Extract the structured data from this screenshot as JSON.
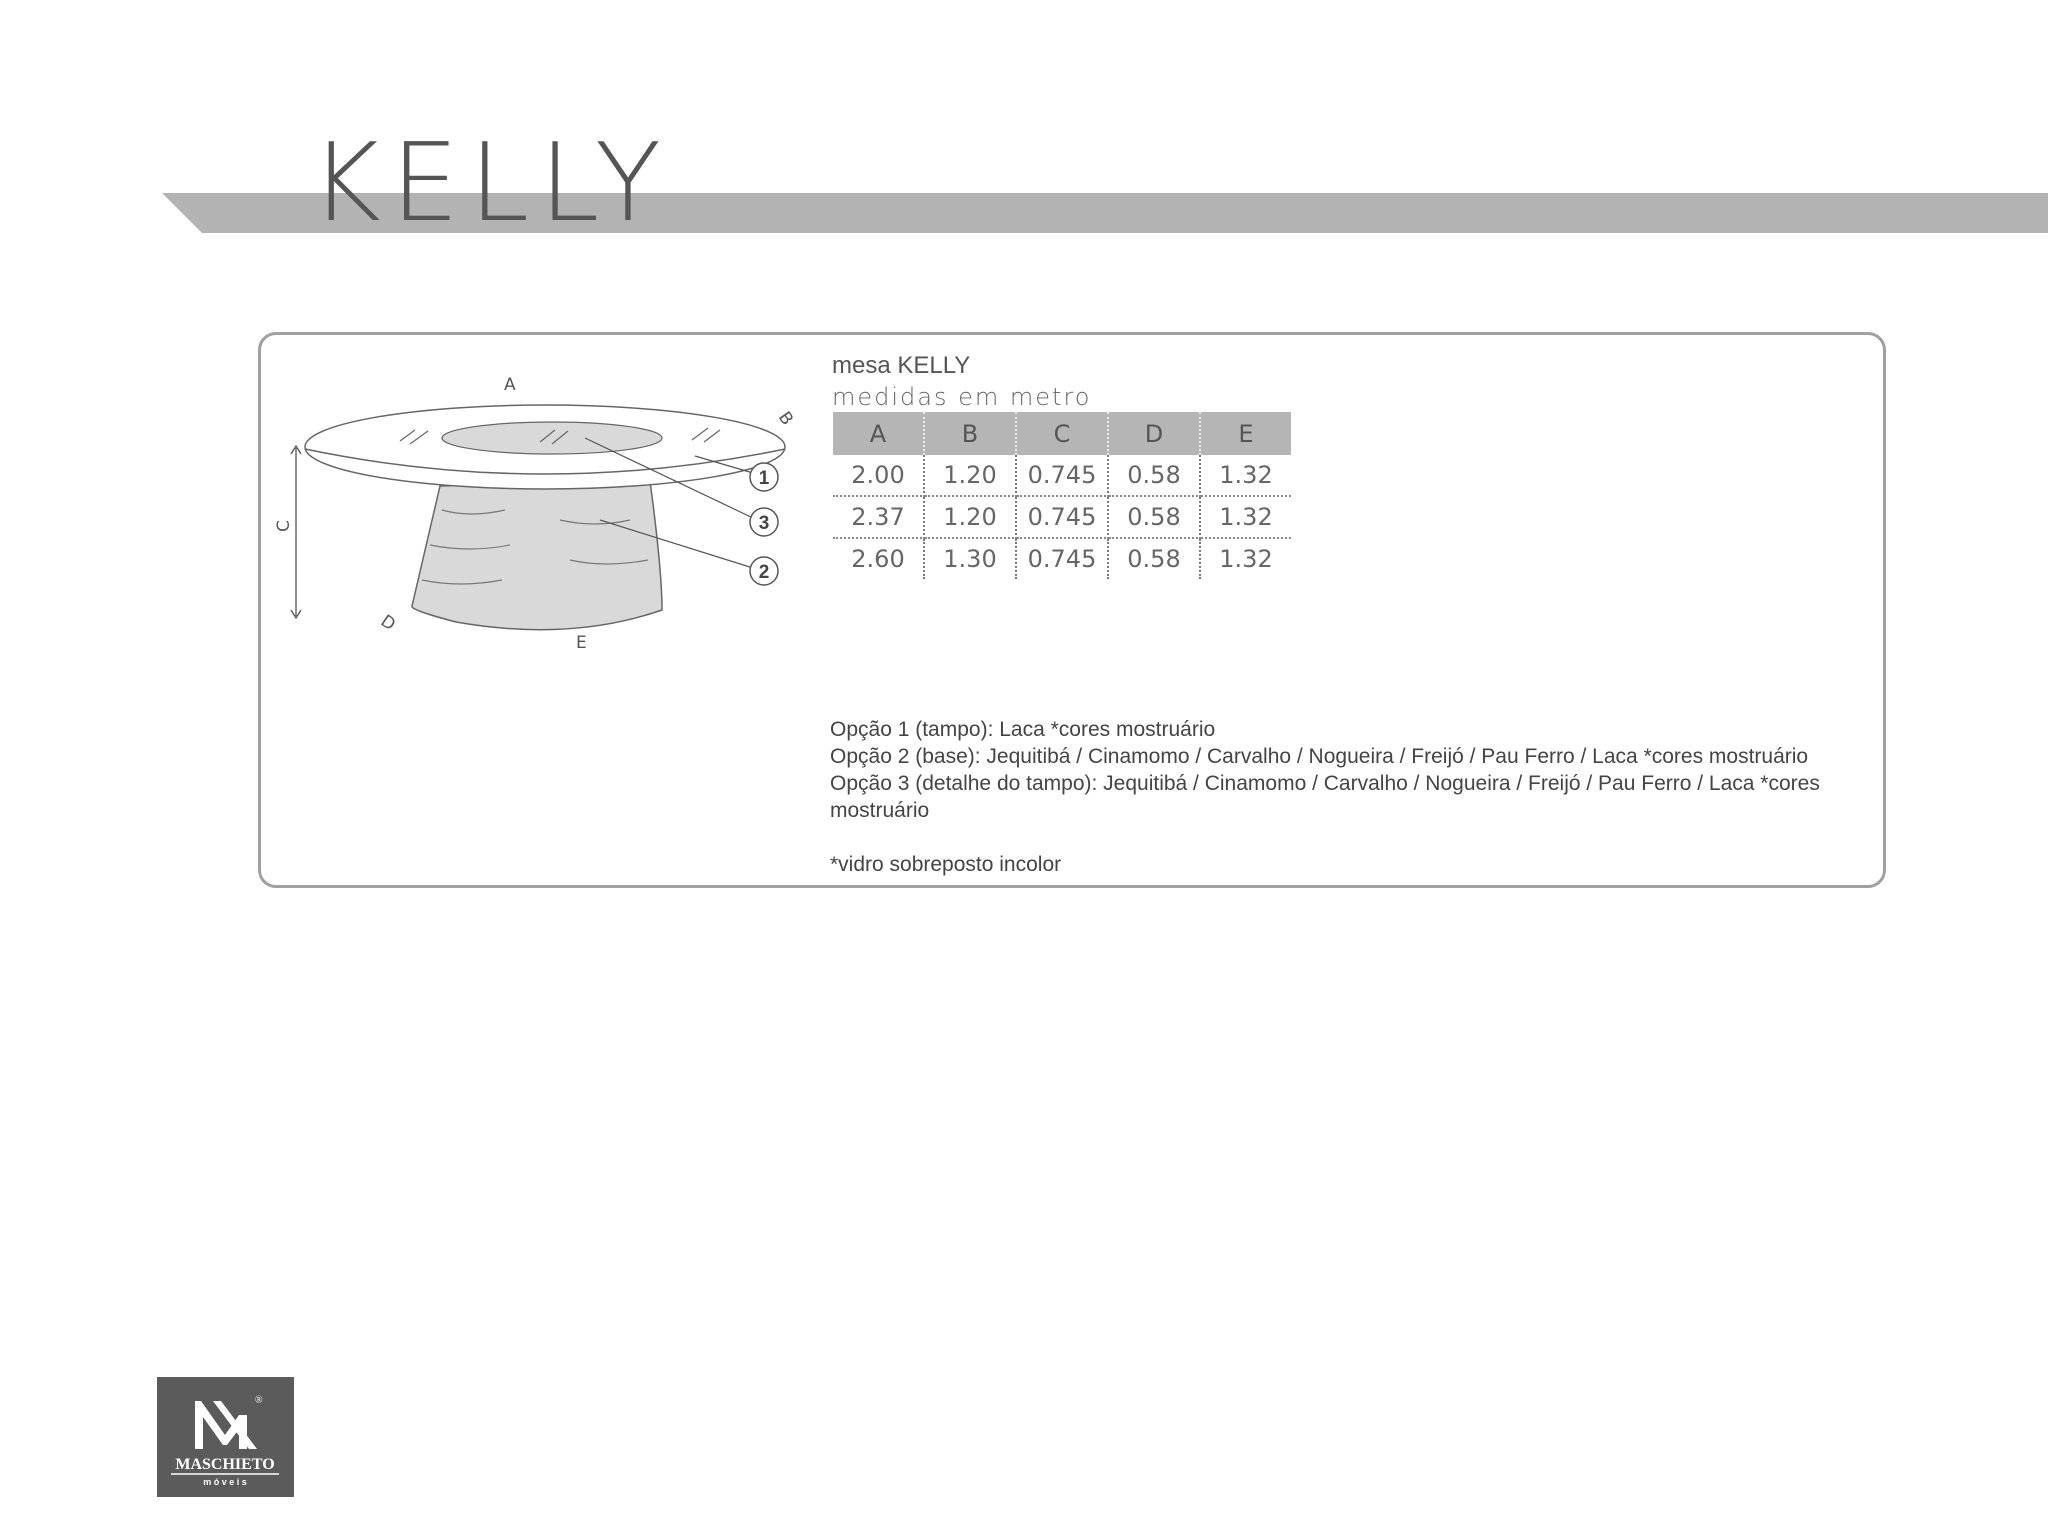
{
  "page": {
    "title": "KELLY"
  },
  "product": {
    "heading": "mesa KELLY",
    "subheading": "medidas em metro"
  },
  "drawing": {
    "dimension_labels": [
      "A",
      "B",
      "C",
      "D",
      "E"
    ],
    "callouts": [
      "1",
      "3",
      "2"
    ]
  },
  "table": {
    "headers": [
      "A",
      "B",
      "C",
      "D",
      "E"
    ],
    "rows": [
      [
        "2.00",
        "1.20",
        "0.745",
        "0.58",
        "1.32"
      ],
      [
        "2.37",
        "1.20",
        "0.745",
        "0.58",
        "1.32"
      ],
      [
        "2.60",
        "1.30",
        "0.745",
        "0.58",
        "1.32"
      ]
    ]
  },
  "notes": {
    "option1": "Opção 1 (tampo): Laca *cores mostruário",
    "option2": "Opção 2 (base): Jequitibá / Cinamomo / Carvalho / Nogueira / Freijó / Pau Ferro / Laca *cores mostruário",
    "option3": "Opção 3 (detalhe do tampo): Jequitibá / Cinamomo / Carvalho / Nogueira / Freijó / Pau Ferro / Laca *cores mostruário",
    "glass": "*vidro sobreposto incolor"
  },
  "logo": {
    "brand": "MASCHIETO",
    "tagline": "m ó v e i s",
    "registered": "®"
  },
  "colors": {
    "banner": "#b3b3b3",
    "table_header": "#b5b5b5",
    "table_base": "#d9d9d9",
    "logo_bg": "#5b5b5b"
  }
}
